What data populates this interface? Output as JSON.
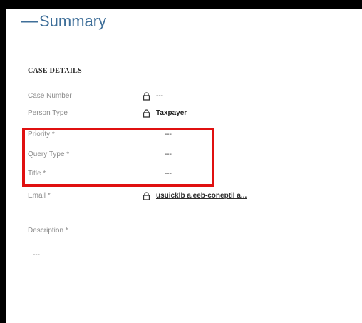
{
  "summary": {
    "title": "Summary",
    "collapse_glyph": "—"
  },
  "case_details": {
    "heading": "CASE DETAILS",
    "fields": [
      {
        "label": "Case Number",
        "value": "---",
        "locked": true
      },
      {
        "label": "Person Type",
        "value": "Taxpayer",
        "locked": true
      },
      {
        "label": "Priority *",
        "value": "---",
        "locked": false
      },
      {
        "label": "Query Type *",
        "value": "---",
        "locked": false
      },
      {
        "label": "Title *",
        "value": "---",
        "locked": false
      },
      {
        "label": "Email *",
        "value": "usuicklb a.eeb-coneptil a...",
        "locked": true
      }
    ],
    "description": {
      "label": "Description *",
      "value": "---"
    }
  },
  "colors": {
    "title": "#3f6f99",
    "highlight": "#e01010",
    "label": "#8a8a8a"
  },
  "icons": {
    "lock": "lock-icon"
  }
}
